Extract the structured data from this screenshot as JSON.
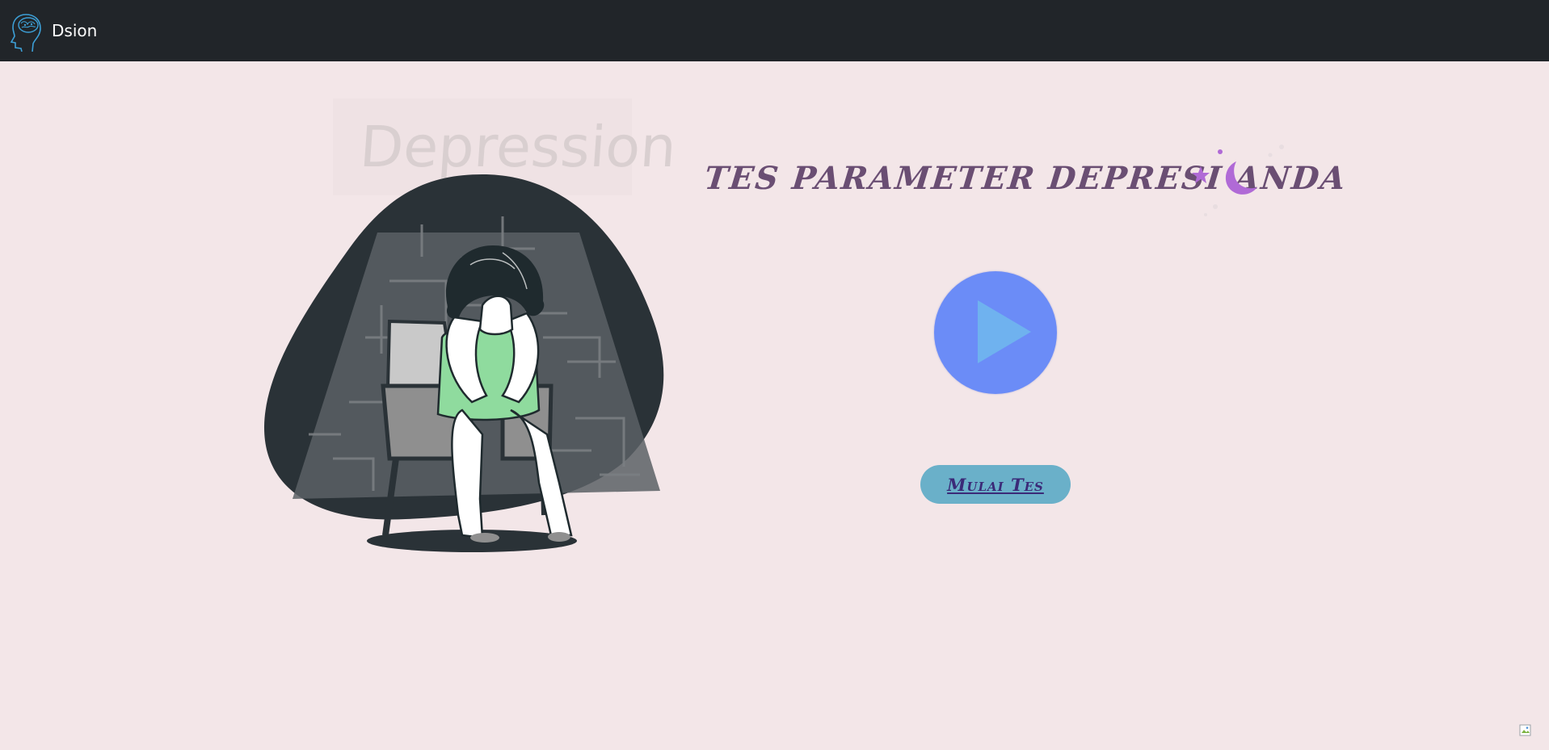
{
  "navbar": {
    "brand_name": "Dsion",
    "logo_icon": "brain-head-icon",
    "bg_color": "#212529"
  },
  "illustration": {
    "sign_text": "Depression",
    "description_icon": "crying-woman-illustration"
  },
  "main": {
    "headline": "TES PARAMETER DEPRESI ANDA",
    "play_icon": "play-icon",
    "start_button_label": "Mulai Tes"
  },
  "colors": {
    "background": "#f3e6e8",
    "headline": "#6a4e73",
    "play_circle": "#6b8cf7",
    "play_triangle": "#6fb2ef",
    "start_button": "#6ab0c9",
    "start_text": "#3b2a78",
    "moon": "#b06ad6"
  }
}
